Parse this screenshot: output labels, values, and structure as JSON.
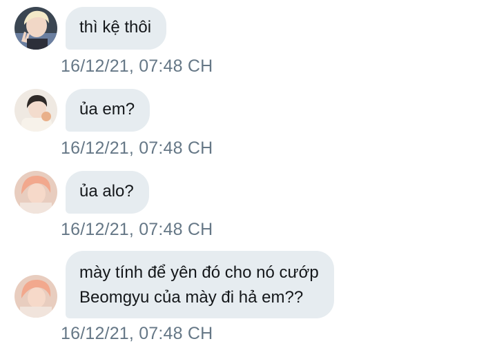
{
  "conversation": {
    "messages": [
      {
        "text": "thì kệ thôi",
        "timestamp": "16/12/21, 07:48 CH",
        "avatar": "avatar-blond-peace-sign"
      },
      {
        "text": "ủa em?",
        "timestamp": "16/12/21, 07:48 CH",
        "avatar": "avatar-dark-hair"
      },
      {
        "text": "ủa alo?",
        "timestamp": "16/12/21, 07:48 CH",
        "avatar": "avatar-peach-hair"
      },
      {
        "text_line1": "mày tính để yên đó cho nó cướp",
        "text_line2": "Beomgyu của mày đi hả em??",
        "timestamp": "16/12/21, 07:48 CH",
        "avatar": "avatar-peach-hair"
      }
    ]
  },
  "colors": {
    "bubble": "#e6ecf0",
    "text": "#14171a",
    "timestamp": "#657786"
  }
}
